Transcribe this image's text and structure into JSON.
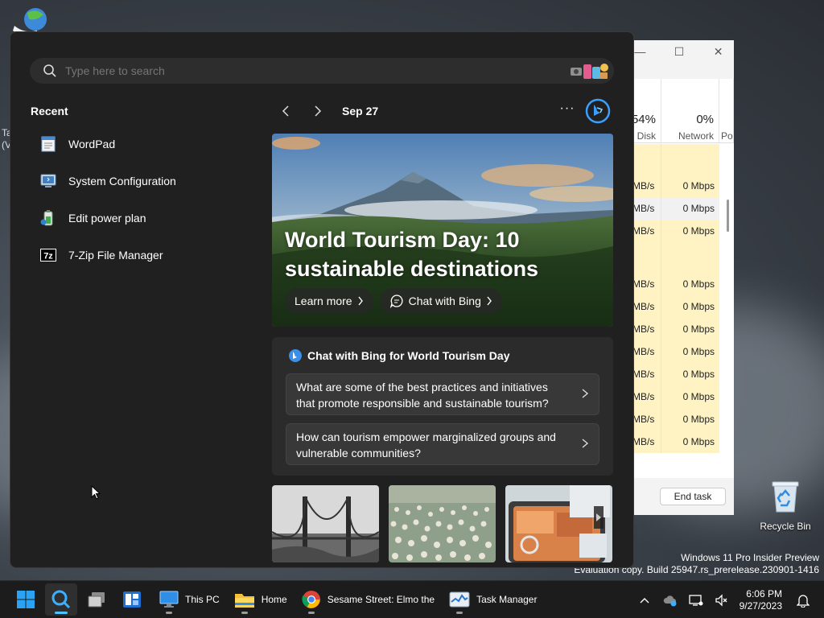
{
  "desktop": {
    "side_text_line1": "Ta",
    "side_text_line2": "(V",
    "recycle_bin_label": "Recycle Bin",
    "watermark_line1": "Windows 11 Pro Insider Preview",
    "watermark_line2": "Evaluation copy. Build 25947.rs_prerelease.230901-1416"
  },
  "task_manager": {
    "disk_pct": "54%",
    "disk_label": "Disk",
    "network_pct": "0%",
    "network_label": "Network",
    "po_label": "Po",
    "end_task_label": "End task",
    "rows": [
      {
        "disk": "",
        "network": ""
      },
      {
        "disk": "MB/s",
        "network": "0 Mbps"
      },
      {
        "disk": "MB/s",
        "network": "0 Mbps"
      },
      {
        "disk": "MB/s",
        "network": "0 Mbps"
      },
      {
        "disk": "",
        "network": ""
      },
      {
        "disk": "MB/s",
        "network": "0 Mbps"
      },
      {
        "disk": "MB/s",
        "network": "0 Mbps"
      },
      {
        "disk": "MB/s",
        "network": "0 Mbps"
      },
      {
        "disk": "MB/s",
        "network": "0 Mbps"
      },
      {
        "disk": "MB/s",
        "network": "0 Mbps"
      },
      {
        "disk": "MB/s",
        "network": "0 Mbps"
      },
      {
        "disk": "MB/s",
        "network": "0 Mbps"
      },
      {
        "disk": "MB/s",
        "network": "0 Mbps"
      }
    ]
  },
  "search": {
    "placeholder": "Type here to search"
  },
  "recent": {
    "title": "Recent",
    "items": [
      {
        "label": "WordPad",
        "icon": "wordpad-icon"
      },
      {
        "label": "System Configuration",
        "icon": "system-configuration-icon"
      },
      {
        "label": "Edit power plan",
        "icon": "power-plan-icon"
      },
      {
        "label": "7-Zip File Manager",
        "icon": "7zip-icon"
      }
    ]
  },
  "highlights": {
    "date": "Sep 27",
    "more_label": "···",
    "hero_title": "World Tourism Day: 10 sustainable destinations",
    "learn_more": "Learn more",
    "chat_with_bing": "Chat with Bing",
    "chat_card_title": "Chat with Bing for World Tourism Day",
    "questions": [
      "What are some of the best practices and initiatives that promote responsible and sustainable tourism?",
      "How can tourism empower marginalized groups and vulnerable communities?"
    ]
  },
  "taskbar": {
    "items": [
      {
        "label": "This PC"
      },
      {
        "label": "Home"
      },
      {
        "label": "Sesame Street: Elmo the"
      },
      {
        "label": "Task Manager"
      }
    ],
    "time": "6:06 PM",
    "date": "9/27/2023"
  },
  "colors": {
    "panel_bg": "#202020",
    "accent": "#4cc2ff",
    "tm_highlight": "#fff3c4"
  }
}
